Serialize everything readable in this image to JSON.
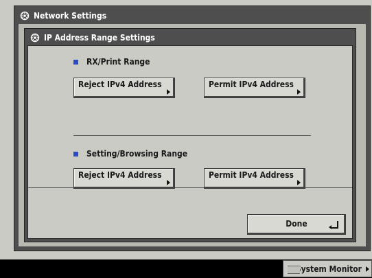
{
  "outer_window": {
    "title": "Network Settings",
    "icon": "gear-icon"
  },
  "inner_window": {
    "title": "IP Address Range Settings",
    "icon": "gear-icon"
  },
  "sections": [
    {
      "label": "RX/Print Range",
      "buttons": [
        "Reject IPv4 Address",
        "Permit IPv4 Address"
      ]
    },
    {
      "label": "Setting/Browsing Range",
      "buttons": [
        "Reject IPv4 Address",
        "Permit IPv4 Address"
      ]
    }
  ],
  "done_label": "Done",
  "status_bar": {
    "system_monitor_label": "System Monitor"
  },
  "colors": {
    "bullet": "#2b4cc4",
    "title_bar": "#4e4e4e",
    "panel": "#c9cbc4"
  }
}
